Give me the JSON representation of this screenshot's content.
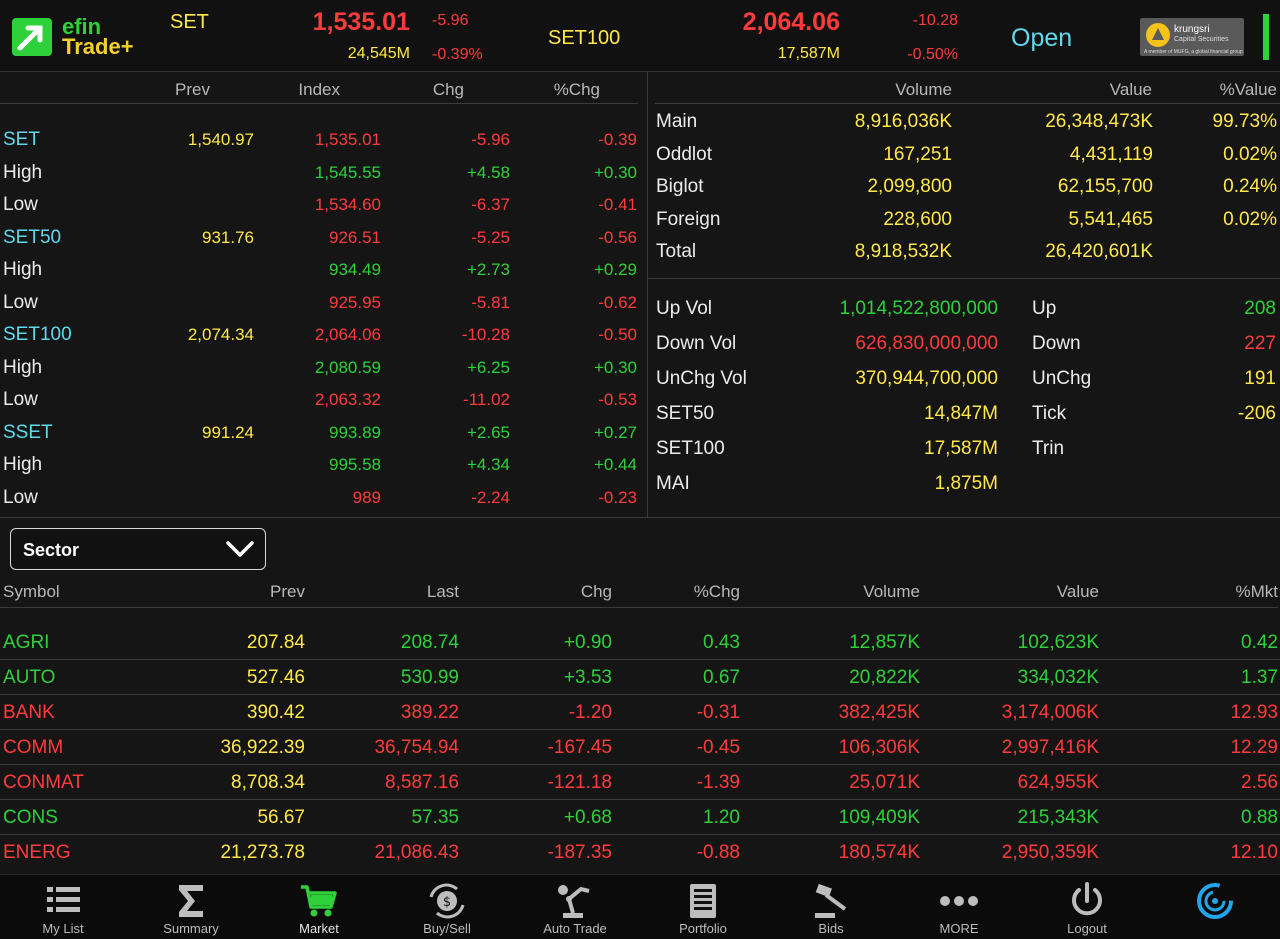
{
  "header": {
    "logo_line1": "efin",
    "logo_line2": "Trade+",
    "set": {
      "label": "SET",
      "value": "1,535.01",
      "chg": "-5.96",
      "volume": "24,545M",
      "pct": "-0.39%"
    },
    "set100": {
      "label": "SET100",
      "value": "2,064.06",
      "chg": "-10.28",
      "volume": "17,587M",
      "pct": "-0.50%"
    },
    "status": "Open",
    "broker": {
      "name": "krungsri",
      "sub": "Capital Securities",
      "foot": "A member of MUFG, a global financial group"
    }
  },
  "index_table": {
    "headers": [
      "Prev",
      "Index",
      "Chg",
      "%Chg"
    ],
    "rows": [
      {
        "name": "SET",
        "name_color": "cyan",
        "prev": "1,540.97",
        "index": "1,535.01",
        "chg": "-5.96",
        "pct": "-0.39",
        "color": "red"
      },
      {
        "name": "High",
        "name_color": "white",
        "prev": "",
        "index": "1,545.55",
        "chg": "+4.58",
        "pct": "+0.30",
        "color": "green"
      },
      {
        "name": "Low",
        "name_color": "white",
        "prev": "",
        "index": "1,534.60",
        "chg": "-6.37",
        "pct": "-0.41",
        "color": "red"
      },
      {
        "name": "SET50",
        "name_color": "cyan",
        "prev": "931.76",
        "index": "926.51",
        "chg": "-5.25",
        "pct": "-0.56",
        "color": "red"
      },
      {
        "name": "High",
        "name_color": "white",
        "prev": "",
        "index": "934.49",
        "chg": "+2.73",
        "pct": "+0.29",
        "color": "green"
      },
      {
        "name": "Low",
        "name_color": "white",
        "prev": "",
        "index": "925.95",
        "chg": "-5.81",
        "pct": "-0.62",
        "color": "red"
      },
      {
        "name": "SET100",
        "name_color": "cyan",
        "prev": "2,074.34",
        "index": "2,064.06",
        "chg": "-10.28",
        "pct": "-0.50",
        "color": "red"
      },
      {
        "name": "High",
        "name_color": "white",
        "prev": "",
        "index": "2,080.59",
        "chg": "+6.25",
        "pct": "+0.30",
        "color": "green"
      },
      {
        "name": "Low",
        "name_color": "white",
        "prev": "",
        "index": "2,063.32",
        "chg": "-11.02",
        "pct": "-0.53",
        "color": "red"
      },
      {
        "name": "SSET",
        "name_color": "cyan",
        "prev": "991.24",
        "index": "993.89",
        "chg": "+2.65",
        "pct": "+0.27",
        "color": "green"
      },
      {
        "name": "High",
        "name_color": "white",
        "prev": "",
        "index": "995.58",
        "chg": "+4.34",
        "pct": "+0.44",
        "color": "green"
      },
      {
        "name": "Low",
        "name_color": "white",
        "prev": "",
        "index": "989",
        "chg": "-2.24",
        "pct": "-0.23",
        "color": "red"
      }
    ]
  },
  "volume_table": {
    "headers": [
      "Volume",
      "Value",
      "%Value"
    ],
    "rows": [
      {
        "name": "Main",
        "volume": "8,916,036K",
        "value": "26,348,473K",
        "pct": "99.73%"
      },
      {
        "name": "Oddlot",
        "volume": "167,251",
        "value": "4,431,119",
        "pct": "0.02%"
      },
      {
        "name": "Biglot",
        "volume": "2,099,800",
        "value": "62,155,700",
        "pct": "0.24%"
      },
      {
        "name": "Foreign",
        "volume": "228,600",
        "value": "5,541,465",
        "pct": "0.02%"
      },
      {
        "name": "Total",
        "volume": "8,918,532K",
        "value": "26,420,601K",
        "pct": ""
      }
    ]
  },
  "breadth": {
    "left": [
      {
        "label": "Up Vol",
        "value": "1,014,522,800,000",
        "color": "green"
      },
      {
        "label": "Down Vol",
        "value": "626,830,000,000",
        "color": "red"
      },
      {
        "label": "UnChg Vol",
        "value": "370,944,700,000",
        "color": "yellow"
      },
      {
        "label": "SET50",
        "value": "14,847M",
        "color": "yellow"
      },
      {
        "label": "SET100",
        "value": "17,587M",
        "color": "yellow"
      },
      {
        "label": "MAI",
        "value": "1,875M",
        "color": "yellow"
      }
    ],
    "right": [
      {
        "label": "Up",
        "value": "208",
        "color": "green"
      },
      {
        "label": "Down",
        "value": "227",
        "color": "red"
      },
      {
        "label": "UnChg",
        "value": "191",
        "color": "yellow"
      },
      {
        "label": "Tick",
        "value": "-206",
        "color": "yellow"
      },
      {
        "label": "Trin",
        "value": "",
        "color": "yellow"
      }
    ]
  },
  "sector_select": {
    "value": "Sector"
  },
  "sector_table": {
    "headers": [
      "Symbol",
      "Prev",
      "Last",
      "Chg",
      "%Chg",
      "Volume",
      "Value",
      "%Mkt"
    ],
    "rows": [
      {
        "symbol": "AGRI",
        "prev": "207.84",
        "last": "208.74",
        "chg": "+0.90",
        "pct": "0.43",
        "volume": "12,857K",
        "value": "102,623K",
        "mkt": "0.42",
        "color": "green"
      },
      {
        "symbol": "AUTO",
        "prev": "527.46",
        "last": "530.99",
        "chg": "+3.53",
        "pct": "0.67",
        "volume": "20,822K",
        "value": "334,032K",
        "mkt": "1.37",
        "color": "green"
      },
      {
        "symbol": "BANK",
        "prev": "390.42",
        "last": "389.22",
        "chg": "-1.20",
        "pct": "-0.31",
        "volume": "382,425K",
        "value": "3,174,006K",
        "mkt": "12.93",
        "color": "red"
      },
      {
        "symbol": "COMM",
        "prev": "36,922.39",
        "last": "36,754.94",
        "chg": "-167.45",
        "pct": "-0.45",
        "volume": "106,306K",
        "value": "2,997,416K",
        "mkt": "12.29",
        "color": "red"
      },
      {
        "symbol": "CONMAT",
        "prev": "8,708.34",
        "last": "8,587.16",
        "chg": "-121.18",
        "pct": "-1.39",
        "volume": "25,071K",
        "value": "624,955K",
        "mkt": "2.56",
        "color": "red"
      },
      {
        "symbol": "CONS",
        "prev": "56.67",
        "last": "57.35",
        "chg": "+0.68",
        "pct": "1.20",
        "volume": "109,409K",
        "value": "215,343K",
        "mkt": "0.88",
        "color": "green"
      },
      {
        "symbol": "ENERG",
        "prev": "21,273.78",
        "last": "21,086.43",
        "chg": "-187.35",
        "pct": "-0.88",
        "volume": "180,574K",
        "value": "2,950,359K",
        "mkt": "12.10",
        "color": "red"
      }
    ]
  },
  "nav": [
    {
      "label": "My List",
      "icon": "list-icon"
    },
    {
      "label": "Summary",
      "icon": "sigma-icon"
    },
    {
      "label": "Market",
      "icon": "cart-icon",
      "active": true
    },
    {
      "label": "Buy/Sell",
      "icon": "exchange-icon"
    },
    {
      "label": "Auto Trade",
      "icon": "robot-arm-icon"
    },
    {
      "label": "Portfolio",
      "icon": "document-icon"
    },
    {
      "label": "Bids",
      "icon": "gavel-icon"
    },
    {
      "label": "MORE",
      "icon": "more-dots-icon"
    },
    {
      "label": "Logout",
      "icon": "power-icon"
    },
    {
      "label": "",
      "icon": "refresh-spinner-icon"
    }
  ],
  "colors": {
    "red": "#ff3b3b",
    "green": "#2ed13a",
    "yellow": "#ffe84a",
    "cyan": "#5fd9ec",
    "white": "#ececec",
    "accent_blue": "#22a6e8"
  }
}
